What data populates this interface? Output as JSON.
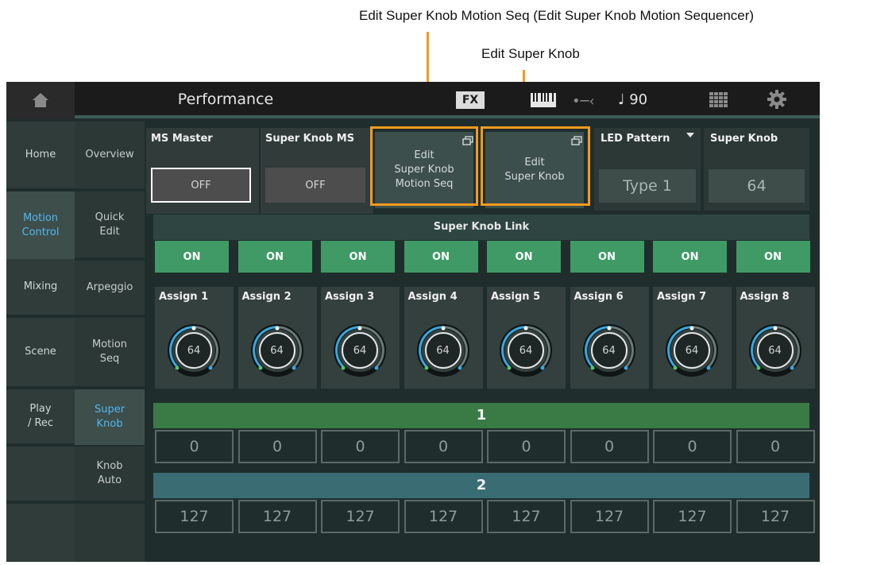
{
  "callouts": {
    "motion_seq": "Edit Super Knob Motion Seq (Edit Super Knob Motion Sequencer)",
    "super_knob": "Edit Super Knob"
  },
  "topbar": {
    "title": "Performance",
    "fx": "FX",
    "tempo": "♩ 90",
    "usb_symbol": "•─‹"
  },
  "tabs_left": [
    "Home",
    "Motion\nControl",
    "Mixing",
    "Scene",
    "Play\n/ Rec"
  ],
  "tabs_right": [
    "Overview",
    "Quick\nEdit",
    "Arpeggio",
    "Motion\nSeq",
    "Super\nKnob",
    "Knob\nAuto"
  ],
  "params": {
    "ms_master": {
      "label": "MS Master",
      "value": "OFF"
    },
    "super_knob_ms": {
      "label": "Super Knob MS",
      "value": "OFF"
    },
    "edit_motion_seq": "Edit\nSuper Knob\nMotion Seq",
    "edit_super_knob": "Edit\nSuper Knob",
    "led_pattern": {
      "label": "LED Pattern",
      "value": "Type 1"
    },
    "super_knob": {
      "label": "Super Knob",
      "value": "64"
    }
  },
  "link": {
    "header": "Super Knob Link",
    "buttons": [
      "ON",
      "ON",
      "ON",
      "ON",
      "ON",
      "ON",
      "ON",
      "ON"
    ]
  },
  "assigns": [
    {
      "label": "Assign 1",
      "value": "64"
    },
    {
      "label": "Assign 2",
      "value": "64"
    },
    {
      "label": "Assign 3",
      "value": "64"
    },
    {
      "label": "Assign 4",
      "value": "64"
    },
    {
      "label": "Assign 5",
      "value": "64"
    },
    {
      "label": "Assign 6",
      "value": "64"
    },
    {
      "label": "Assign 7",
      "value": "64"
    },
    {
      "label": "Assign 8",
      "value": "64"
    }
  ],
  "range1": {
    "label": "1",
    "values": [
      "0",
      "0",
      "0",
      "0",
      "0",
      "0",
      "0",
      "0"
    ]
  },
  "range2": {
    "label": "2",
    "values": [
      "127",
      "127",
      "127",
      "127",
      "127",
      "127",
      "127",
      "127"
    ]
  },
  "colors": {
    "accent_highlight": "#f39a1e",
    "on_button": "#3f9a66",
    "selected_tab_text": "#4fb8f0",
    "knob_arc": "#3aa6e0",
    "range1_bar": "#3a7a45",
    "range2_bar": "#3a6c74"
  }
}
